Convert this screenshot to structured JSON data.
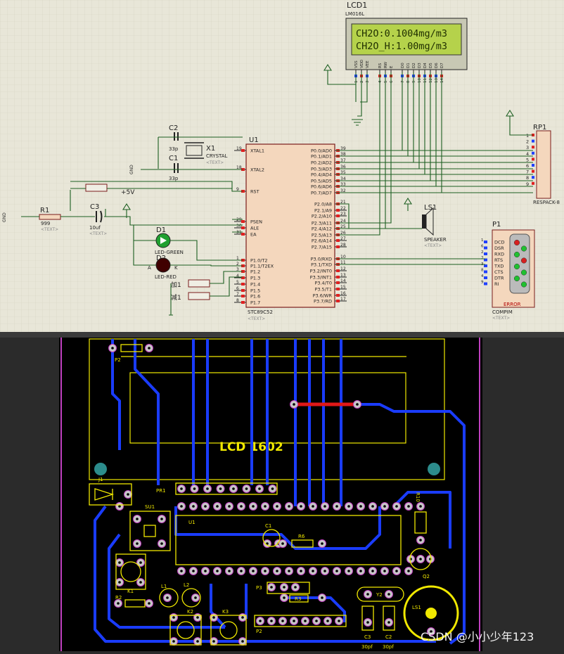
{
  "colors": {
    "schematic_bg": "#e8e6d8",
    "grid": "#d2d0c0",
    "wire": "#1b5e20",
    "chip_fill": "#f4d7bd",
    "chip_stroke": "#7a1c1c",
    "pin_red": "#e02020",
    "pin_blue": "#2040ff",
    "lcd_screen": "#b5d24b",
    "lcd_text": "#203000",
    "pcb_bg": "#000000",
    "trace_blue": "#1a3cff",
    "silk_yellow": "#f0e800",
    "pad": "#c8c8c8",
    "magenta": "#c040c0",
    "teal": "#2c8c8c"
  },
  "lcd": {
    "ref": "LCD1",
    "model": "LM016L",
    "line1": "CH2O:0.1004mg/m3",
    "line2": "CH2O_H:1.00mg/m3",
    "pins": [
      "VSS",
      "VDD",
      "VEE",
      "RS",
      "RW",
      "E",
      "D0",
      "D1",
      "D2",
      "D3",
      "D4",
      "D5",
      "D6",
      "D7"
    ],
    "pin_numbers": [
      "1",
      "2",
      "3",
      "4",
      "5",
      "6",
      "7",
      "8",
      "9",
      "10",
      "11",
      "12",
      "13",
      "14"
    ]
  },
  "mcu": {
    "ref": "U1",
    "model": "STC89C52",
    "text_tag": "<TEXT>",
    "left_pins": [
      {
        "num": "19",
        "name": "XTAL1"
      },
      {
        "num": "18",
        "name": "XTAL2"
      },
      {
        "num": "9",
        "name": "RST"
      },
      {
        "num": "29",
        "name": "PSEN"
      },
      {
        "num": "30",
        "name": "ALE"
      },
      {
        "num": "31",
        "name": "EA"
      },
      {
        "num": "1",
        "name": "P1.0/T2"
      },
      {
        "num": "2",
        "name": "P1.1/T2EX"
      },
      {
        "num": "3",
        "name": "P1.2"
      },
      {
        "num": "4",
        "name": "P1.3"
      },
      {
        "num": "5",
        "name": "P1.4"
      },
      {
        "num": "6",
        "name": "P1.5"
      },
      {
        "num": "7",
        "name": "P1.6"
      },
      {
        "num": "8",
        "name": "P1.7"
      }
    ],
    "right_pins": [
      {
        "num": "39",
        "name": "P0.0/AD0"
      },
      {
        "num": "38",
        "name": "P0.1/AD1"
      },
      {
        "num": "37",
        "name": "P0.2/AD2"
      },
      {
        "num": "36",
        "name": "P0.3/AD3"
      },
      {
        "num": "35",
        "name": "P0.4/AD4"
      },
      {
        "num": "34",
        "name": "P0.5/AD5"
      },
      {
        "num": "33",
        "name": "P0.6/AD6"
      },
      {
        "num": "32",
        "name": "P0.7/AD7"
      },
      {
        "num": "21",
        "name": "P2.0/A8"
      },
      {
        "num": "22",
        "name": "P2.1/A9"
      },
      {
        "num": "23",
        "name": "P2.2/A10"
      },
      {
        "num": "24",
        "name": "P2.3/A11"
      },
      {
        "num": "25",
        "name": "P2.4/A12"
      },
      {
        "num": "26",
        "name": "P2.5/A13"
      },
      {
        "num": "27",
        "name": "P2.6/A14"
      },
      {
        "num": "28",
        "name": "P2.7/A15"
      },
      {
        "num": "10",
        "name": "P3.0/RXD"
      },
      {
        "num": "11",
        "name": "P3.1/TXD"
      },
      {
        "num": "12",
        "name": "P3.2/INT0"
      },
      {
        "num": "13",
        "name": "P3.3/INT1"
      },
      {
        "num": "14",
        "name": "P3.4/T0"
      },
      {
        "num": "15",
        "name": "P3.5/T1"
      },
      {
        "num": "16",
        "name": "P3.6/WR"
      },
      {
        "num": "17",
        "name": "P3.7/RD"
      }
    ]
  },
  "components": {
    "c2_ref": "C2",
    "c2_val": "33p",
    "c1_ref": "C1",
    "c1_val": "33p",
    "x1_ref": "X1",
    "x1_val": "CRYSTAL",
    "r1_ref": "R1",
    "r1_val": "999",
    "c3_ref": "C3",
    "c3_val": "10uf",
    "d1_ref": "D1",
    "d1_val": "LED-GREEN",
    "d2_ref": "D2",
    "d2_val": "LED-RED",
    "d2_a": "A",
    "d2_k": "K",
    "vcc_label": "+5V",
    "gnd_label": "GND",
    "text_tag": "<TEXT>",
    "rp1_ref": "RP1",
    "rp1_val": "RESPACK-8",
    "rp1_pins": [
      "1",
      "2",
      "3",
      "4",
      "5",
      "6",
      "7",
      "8",
      "9"
    ],
    "ls1_ref": "LS1",
    "ls1_val": "SPEAKER",
    "p1_ref": "P1",
    "p1_val": "COMPIM",
    "p1_signals": [
      {
        "num": "1",
        "name": "DCD"
      },
      {
        "num": "6",
        "name": "DSR"
      },
      {
        "num": "2",
        "name": "RXD"
      },
      {
        "num": "7",
        "name": "RTS"
      },
      {
        "num": "3",
        "name": "TXD"
      },
      {
        "num": "8",
        "name": "CTS"
      },
      {
        "num": "4",
        "name": "DTR"
      },
      {
        "num": "9",
        "name": "RI"
      }
    ],
    "p1_error": "ERROR",
    "btn1_label": "加1",
    "btn2_label": "减1"
  },
  "pcb": {
    "lcd_label": "LCD   1602",
    "p2_top": "P2",
    "j1": "J1",
    "pr1": "PR1",
    "su1": "SU1",
    "u1": "U1",
    "c1": "C1",
    "r6": "R6",
    "r10": "R10",
    "q2": "Q2",
    "k1": "K1",
    "r2": "R2",
    "l1": "L1",
    "l2": "L2",
    "p3": "P3",
    "r3": "R3",
    "y2": "Y2",
    "ls1": "LS1",
    "k2": "K2",
    "k3": "K3",
    "p2_bottom": "P2",
    "c3": "C3",
    "c2": "C2",
    "c3_val": "30pf",
    "c2_val": "30pf",
    "watermark": "CSDN @小小少年123"
  }
}
